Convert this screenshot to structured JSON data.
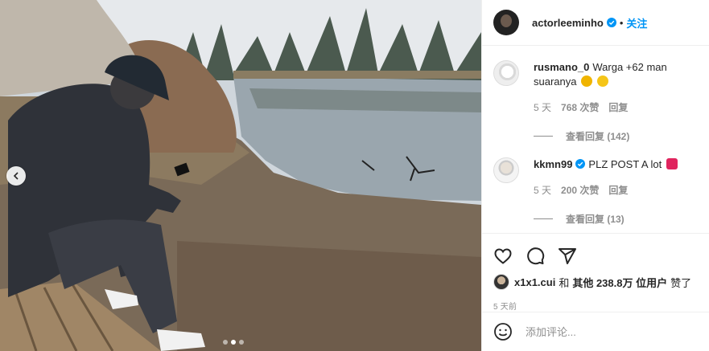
{
  "post": {
    "username": "actorleeminho",
    "separator": "•",
    "follow_label": "关注",
    "verified_icon": "verified-badge-icon",
    "accent_color": "#0095f6"
  },
  "media": {
    "slide_count": 3,
    "active_slide": 2,
    "prev_icon": "chevron-left-icon"
  },
  "comments": [
    {
      "user": "rusmano_0",
      "text": "Warga +62 man suaranya",
      "emojis": [
        "folded-hands-emoji",
        "laughing-emoji"
      ],
      "time": "5 天",
      "likes": "768 次赞",
      "reply_label": "回复",
      "view_replies": "查看回复 (142)"
    },
    {
      "user": "kkmn99",
      "verified": true,
      "text": "PLZ POST A lot",
      "emojis": [
        "red-heart-emoji"
      ],
      "time": "5 天",
      "likes": "200 次赞",
      "reply_label": "回复",
      "view_replies": "查看回复 (13)"
    }
  ],
  "actions": {
    "like_icon": "heart-icon",
    "comment_icon": "comment-icon",
    "share_icon": "paper-plane-icon"
  },
  "likes": {
    "user": "x1x1.cui",
    "and": "和",
    "others": "其他 238.8万 位用户",
    "suffix": "赞了"
  },
  "timestamp": "5 天前",
  "add_comment": {
    "emoji_icon": "smiley-icon",
    "placeholder": "添加评论..."
  }
}
